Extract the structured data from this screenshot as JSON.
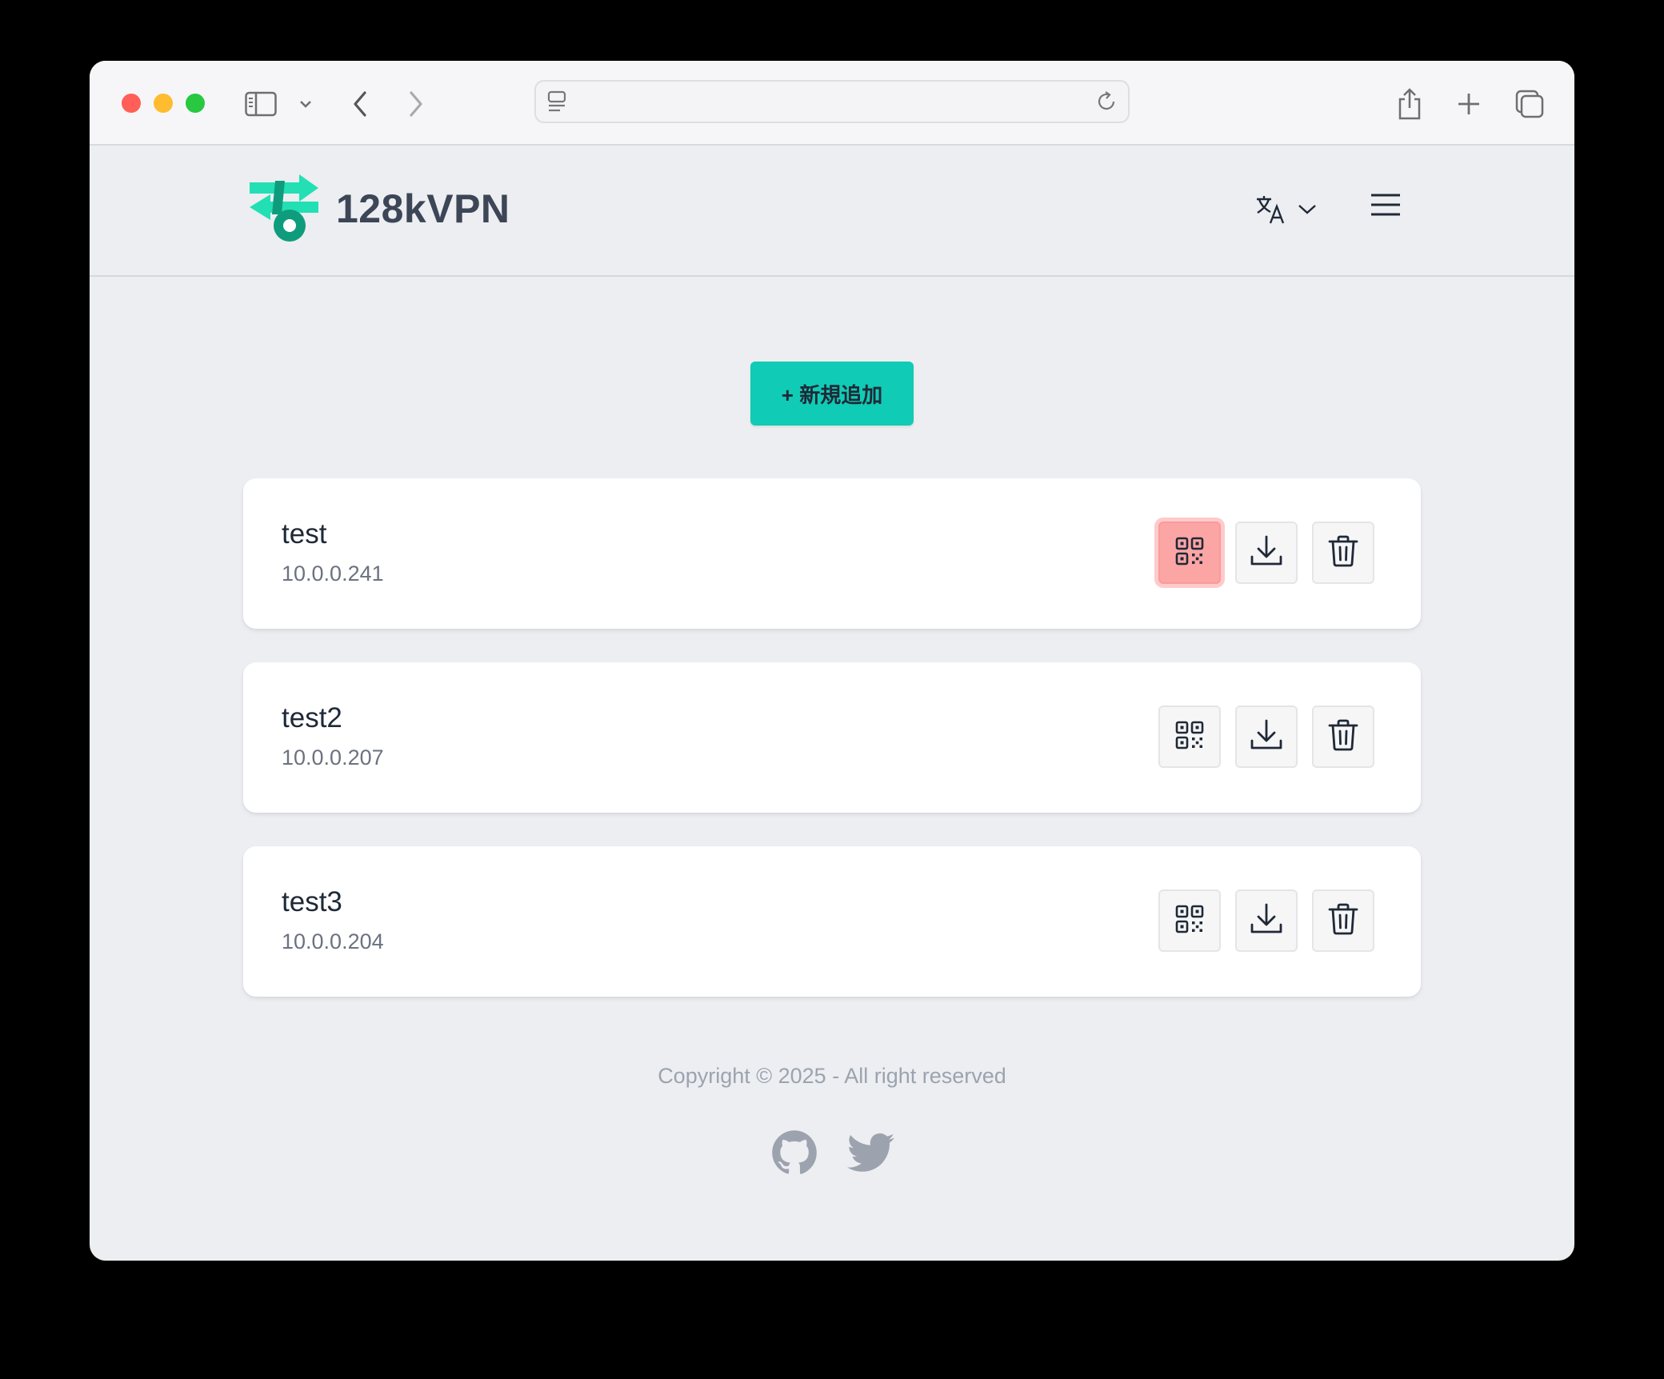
{
  "browser": {
    "url": ""
  },
  "header": {
    "brand": "128kVPN"
  },
  "main": {
    "add_button_label": "+ 新規追加",
    "clients": [
      {
        "name": "test",
        "ip": "10.0.0.241",
        "qr_active": true
      },
      {
        "name": "test2",
        "ip": "10.0.0.207",
        "qr_active": false
      },
      {
        "name": "test3",
        "ip": "10.0.0.204",
        "qr_active": false
      }
    ]
  },
  "footer": {
    "copyright": "Copyright © 2025 - All right reserved",
    "social": [
      "github-icon",
      "twitter-icon"
    ]
  },
  "colors": {
    "accent": "#10cbb5",
    "qr_active": "#fca5a5",
    "page_bg": "#eceef1"
  }
}
